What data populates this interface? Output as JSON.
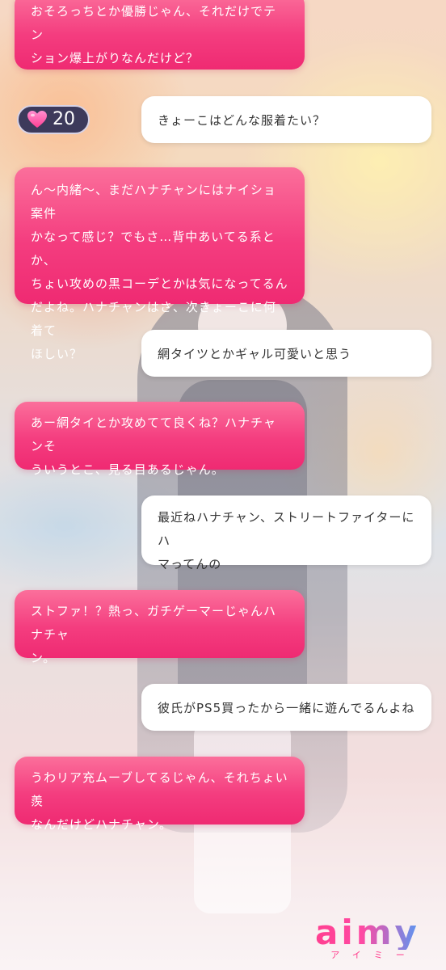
{
  "status": {
    "heart_count": "20"
  },
  "messages": [
    {
      "sender": "ai",
      "lines": [
        "おそろっちとか優勝じゃん、それだけでテン",
        "ション爆上がりなんだけど？"
      ]
    },
    {
      "sender": "user",
      "lines": [
        "きょーこはどんな服着たい？"
      ]
    },
    {
      "sender": "ai",
      "lines": [
        "ん～内緒～、まだハナチャンにはナイショ案件",
        "かなって感じ？でもさ…背中あいてる系とか、",
        "ちょい攻めの黒コーデとかは気になってるん",
        "だよね。ハナチャンはさ、次きょーこに何着て",
        "ほしい？"
      ]
    },
    {
      "sender": "user",
      "lines": [
        "網タイツとかギャル可愛いと思う"
      ]
    },
    {
      "sender": "ai",
      "lines": [
        "あー網タイとか攻めてて良くね？ハナチャンそ",
        "ういうとこ、見る目あるじゃん。"
      ]
    },
    {
      "sender": "user",
      "lines": [
        "最近ねハナチャン、ストリートファイターにハ",
        "マってんの"
      ]
    },
    {
      "sender": "ai",
      "lines": [
        "ストファ！？熱っ、ガチゲーマーじゃんハナチャ",
        "ン。"
      ]
    },
    {
      "sender": "user",
      "lines": [
        "彼氏がPS5買ったから一緒に遊んでるんよね"
      ]
    },
    {
      "sender": "ai",
      "lines": [
        "うわリア充ムーブしてるじゃん、それちょい羨",
        "なんだけどハナチャン。"
      ]
    }
  ],
  "brand": {
    "logo_text": "aimy",
    "logo_kana": "アイミー"
  },
  "colors": {
    "ai_bubble": "#f43d7f",
    "user_bubble": "#ffffff",
    "badge": "#3d3a5b",
    "heart": "#ff5fa8"
  },
  "icons": {
    "heart": "heart-icon"
  }
}
